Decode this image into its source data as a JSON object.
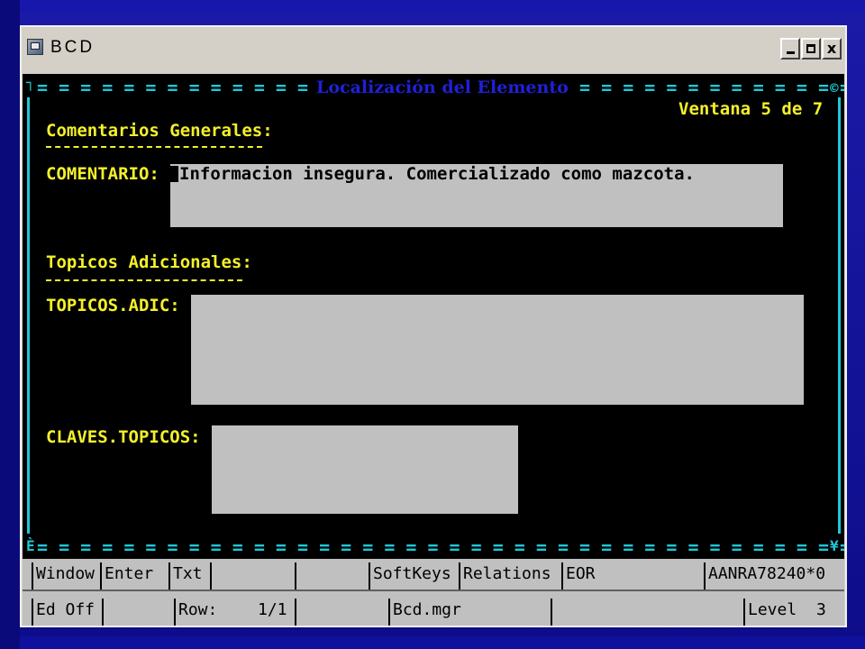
{
  "window": {
    "title": "BCD",
    "controls": {
      "minimize": "minimize",
      "maximize": "maximize",
      "close": "x"
    }
  },
  "screen": {
    "heading": "Localización del Elemento",
    "rule_top": "= = = = = = = = = = = = = = = = = = = = = = = = = = = = = = = = = = = = = = = = = = = = = = = =",
    "rule_bottom": "= = = = = = = = = = = = = = = = = = = = = = = = = = = = = = = = = = = = = = = = = = = = = = = =",
    "corner_tl": "┐",
    "corner_tr": "©",
    "corner_bl": "È",
    "corner_br": "¥",
    "window_indicator": "Ventana 5 de 7",
    "section_comments": {
      "title": "Comentarios Generales:",
      "field_label": "COMENTARIO:",
      "field_value": "Informacion insegura. Comercializado como mazcota."
    },
    "section_topics": {
      "title": "Topicos Adicionales:",
      "field_topics_label": "TOPICOS.ADIC:",
      "field_topics_value": "",
      "field_keys_label": "CLAVES.TOPICOS:",
      "field_keys_value": ""
    }
  },
  "status_bar": {
    "row1": [
      "Window",
      "Enter",
      "Txt",
      "",
      "",
      "SoftKeys",
      "Relations",
      "EOR",
      "",
      "AANRA78240*0"
    ],
    "row2": [
      "Ed Off",
      "",
      "Row:",
      "1/1",
      "",
      "Bcd.mgr",
      "",
      "Level",
      "3"
    ]
  },
  "colors": {
    "slide_background": "#1414a0",
    "terminal_background": "#000000",
    "label_text": "#f4f02a",
    "rule_cyan": "#1ec8d8",
    "heading_blue": "#2020d8",
    "field_gray": "#c0c0c0"
  }
}
